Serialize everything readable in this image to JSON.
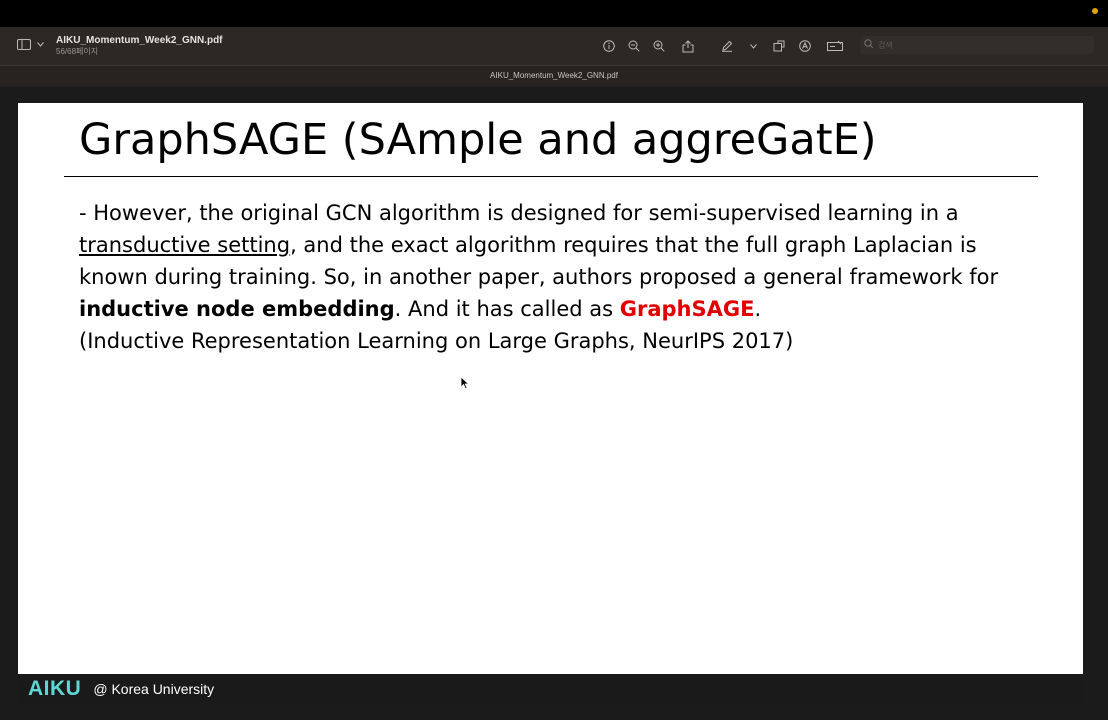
{
  "toolbar": {
    "doc_title": "AIKU_Momentum_Week2_GNN.pdf",
    "page_indicator": "56/68페이지",
    "search": {
      "placeholder": "검색",
      "value": ""
    },
    "icons": [
      "sidebar-icon",
      "chevron-down-icon",
      "info-icon",
      "zoom-out-icon",
      "zoom-in-icon",
      "share-icon",
      "pen-icon",
      "chevron-down-icon",
      "rotate-icon",
      "markup-icon",
      "form-icon",
      "search-icon"
    ]
  },
  "window": {
    "title": "AIKU_Momentum_Week2_GNN.pdf"
  },
  "slide": {
    "title": "GraphSAGE (SAmple and aggreGatE)",
    "paragraph": {
      "l1": "- However, the original GCN algorithm is designed for semi-supervised learning in a",
      "l2_link": "transductive setting",
      "l2_rest": ", and the exact algorithm requires that the full graph Laplacian is",
      "l3": "known during training. So, in another paper, authors proposed a general framework for",
      "l4_bold": "inductive node embedding",
      "l4_mid": ". And it has called as ",
      "l4_highlight": "GraphSAGE",
      "l4_end": ".",
      "l5": "(Inductive Representation Learning on Large Graphs, NeurIPS 2017)"
    },
    "footer": {
      "logo": "AIKU",
      "affiliation": "@ Korea University"
    }
  },
  "colors": {
    "highlight": "#e00000",
    "logo": "#5ed7d7",
    "toolbar_bg": "#2b2826"
  }
}
